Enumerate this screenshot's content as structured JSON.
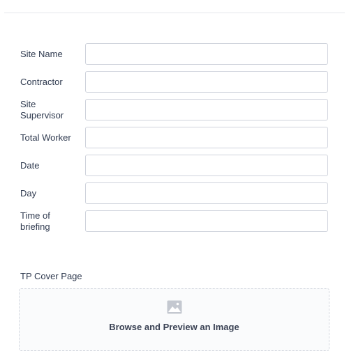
{
  "form": {
    "fields": [
      {
        "label": "Site Name",
        "value": "",
        "placeholder": ""
      },
      {
        "label": "Contractor",
        "value": "",
        "placeholder": ""
      },
      {
        "label": "Site Supervisor",
        "value": "",
        "placeholder": ""
      },
      {
        "label": "Total Worker",
        "value": "",
        "placeholder": ""
      },
      {
        "label": "Date",
        "value": "",
        "placeholder": ""
      },
      {
        "label": "Day",
        "value": "",
        "placeholder": ""
      },
      {
        "label": "Time of briefing",
        "value": "",
        "placeholder": ""
      }
    ]
  },
  "upload": {
    "section_label": "TP Cover Page",
    "icon": "image-icon",
    "prompt": "Browse and Preview an Image"
  },
  "colors": {
    "border": "#cfd3dc",
    "text": "#2f3a4f",
    "icon": "#c4c8d0"
  }
}
